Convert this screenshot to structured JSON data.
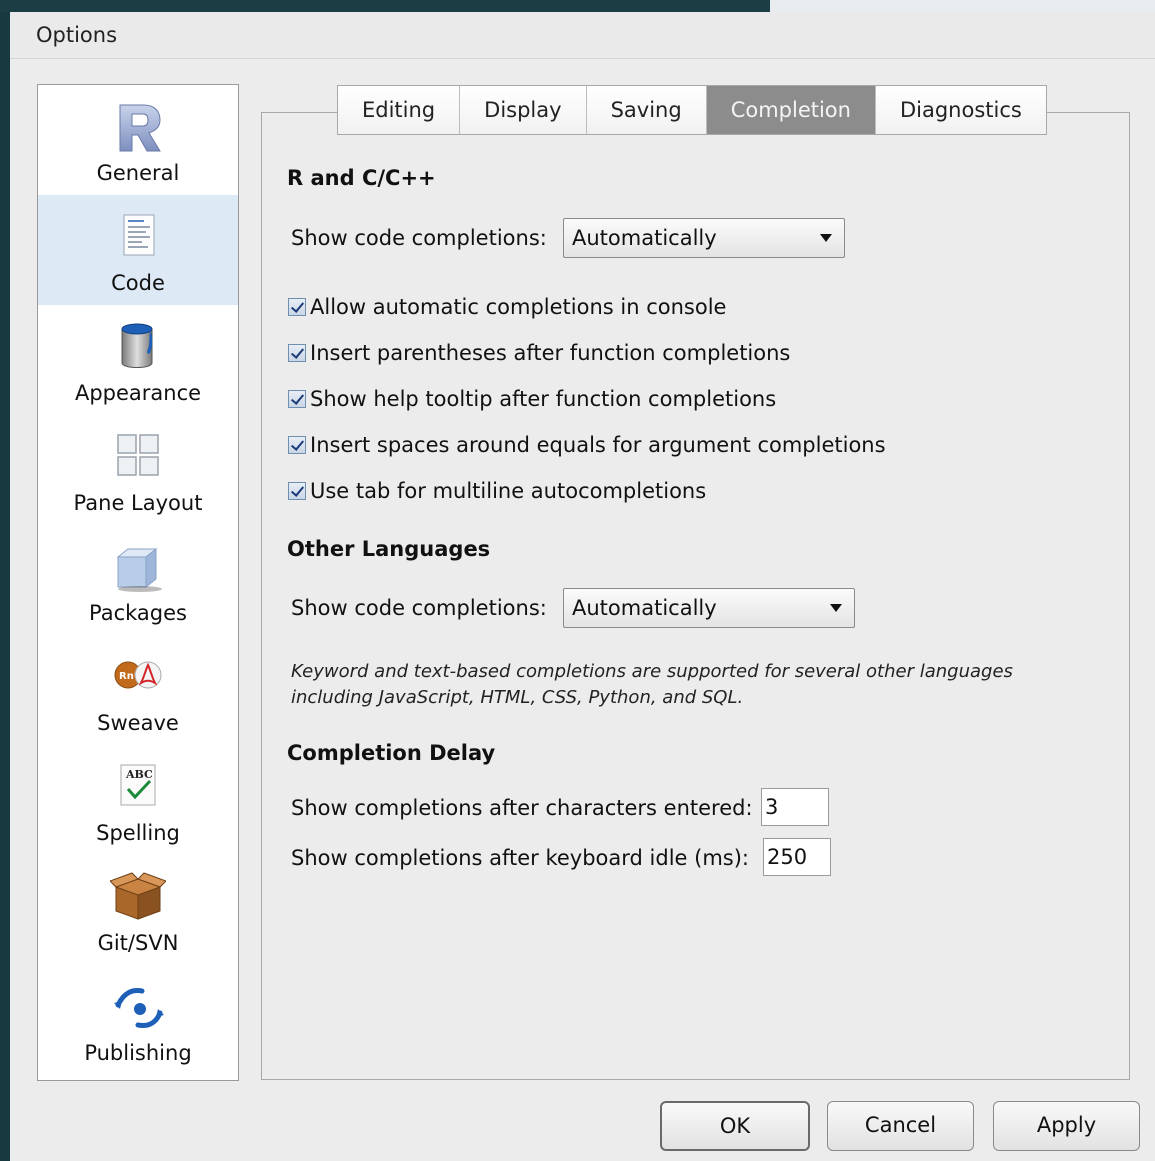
{
  "window": {
    "title": "Options"
  },
  "sidebar": {
    "items": [
      {
        "label": "General",
        "icon": "r-logo-icon"
      },
      {
        "label": "Code",
        "icon": "code-document-icon",
        "active": true
      },
      {
        "label": "Appearance",
        "icon": "paint-bucket-icon"
      },
      {
        "label": "Pane Layout",
        "icon": "pane-grid-icon"
      },
      {
        "label": "Packages",
        "icon": "package-box-icon"
      },
      {
        "label": "Sweave",
        "icon": "sweave-pdf-icon"
      },
      {
        "label": "Spelling",
        "icon": "spelling-abc-icon"
      },
      {
        "label": "Git/SVN",
        "icon": "git-box-icon"
      },
      {
        "label": "Publishing",
        "icon": "publishing-icon"
      }
    ]
  },
  "tabs": [
    {
      "label": "Editing"
    },
    {
      "label": "Display"
    },
    {
      "label": "Saving"
    },
    {
      "label": "Completion",
      "active": true
    },
    {
      "label": "Diagnostics"
    }
  ],
  "r_section": {
    "title": "R and C/C++",
    "show_label": "Show code completions:",
    "show_value": "Automatically",
    "checkboxes": [
      {
        "label": "Allow automatic completions in console",
        "checked": true
      },
      {
        "label": "Insert parentheses after function completions",
        "checked": true
      },
      {
        "label": "Show help tooltip after function completions",
        "checked": true
      },
      {
        "label": "Insert spaces around equals for argument completions",
        "checked": true
      },
      {
        "label": "Use tab for multiline autocompletions",
        "checked": true
      }
    ]
  },
  "other_section": {
    "title": "Other Languages",
    "show_label": "Show code completions:",
    "show_value": "Automatically",
    "note_line1": "Keyword and text-based completions are supported for several other languages",
    "note_line2": "including JavaScript, HTML, CSS, Python, and SQL."
  },
  "delay_section": {
    "title": "Completion Delay",
    "chars_label": "Show completions after characters entered:",
    "chars_value": "3",
    "idle_label": "Show completions after keyboard idle (ms):",
    "idle_value": "250"
  },
  "buttons": {
    "ok": "OK",
    "cancel": "Cancel",
    "apply": "Apply"
  },
  "colors": {
    "active_tab": "#8c8c8c",
    "active_sidebar": "#dde9f5",
    "check_mark": "#1b3a7a"
  }
}
